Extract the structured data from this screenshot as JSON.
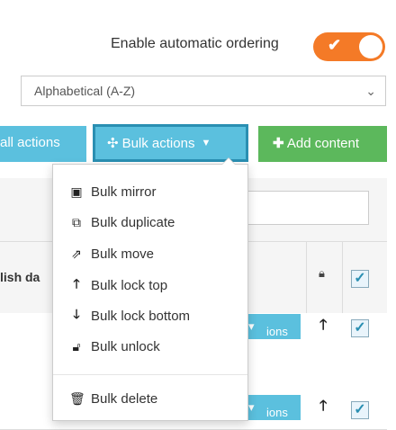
{
  "ordering": {
    "label": "Enable automatic ordering",
    "enabled": true
  },
  "sort_select": {
    "value": "Alphabetical (A-Z)"
  },
  "toolbar": {
    "all_actions_label": "all actions",
    "bulk_actions_label": "Bulk actions",
    "add_content_label": "Add content"
  },
  "table": {
    "publish_column": "lish da",
    "row_action_label": "ions"
  },
  "bulk_menu": {
    "items": [
      {
        "label": "Bulk mirror",
        "icon": "mirror-icon"
      },
      {
        "label": "Bulk duplicate",
        "icon": "duplicate-icon"
      },
      {
        "label": "Bulk move",
        "icon": "external-move-icon"
      },
      {
        "label": "Bulk lock top",
        "icon": "arrow-up-icon"
      },
      {
        "label": "Bulk lock bottom",
        "icon": "arrow-down-icon"
      },
      {
        "label": "Bulk unlock",
        "icon": "unlock-icon"
      },
      {
        "label": "Bulk delete",
        "icon": "trash-icon"
      }
    ]
  },
  "colors": {
    "toggle": "#f47a27",
    "info_button": "#5bc0de",
    "success_button": "#5cb85c",
    "active_border": "#2a8fb2"
  }
}
